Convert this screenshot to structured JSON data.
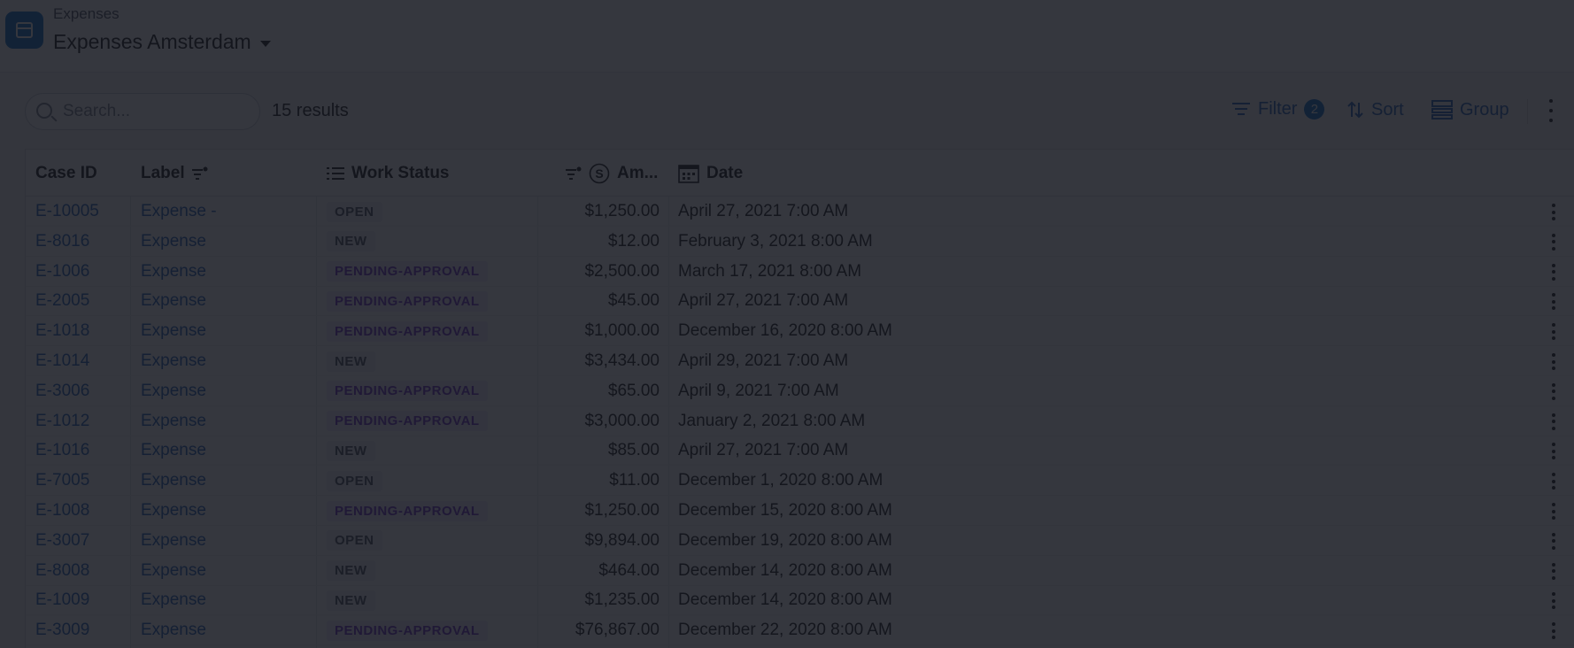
{
  "header": {
    "breadcrumb": "Expenses",
    "title": "Expenses Amsterdam"
  },
  "toolbar": {
    "search_placeholder": "Search...",
    "results": "15 results",
    "filter_label": "Filter",
    "filter_count": "2",
    "sort_label": "Sort",
    "group_label": "Group"
  },
  "table": {
    "columns": {
      "case_id": "Case ID",
      "label": "Label",
      "work_status": "Work Status",
      "amount": "Am...",
      "date": "Date"
    },
    "rows": [
      {
        "case_id": "E-10005",
        "label": "Expense -",
        "status": "OPEN",
        "amount": "$1,250.00",
        "date": "April 27, 2021 7:00 AM"
      },
      {
        "case_id": "E-8016",
        "label": "Expense",
        "status": "NEW",
        "amount": "$12.00",
        "date": "February 3, 2021 8:00 AM"
      },
      {
        "case_id": "E-1006",
        "label": "Expense",
        "status": "PENDING-APPROVAL",
        "amount": "$2,500.00",
        "date": "March 17, 2021 8:00 AM"
      },
      {
        "case_id": "E-2005",
        "label": "Expense",
        "status": "PENDING-APPROVAL",
        "amount": "$45.00",
        "date": "April 27, 2021 7:00 AM"
      },
      {
        "case_id": "E-1018",
        "label": "Expense",
        "status": "PENDING-APPROVAL",
        "amount": "$1,000.00",
        "date": "December 16, 2020 8:00 AM"
      },
      {
        "case_id": "E-1014",
        "label": "Expense",
        "status": "NEW",
        "amount": "$3,434.00",
        "date": "April 29, 2021 7:00 AM"
      },
      {
        "case_id": "E-3006",
        "label": "Expense",
        "status": "PENDING-APPROVAL",
        "amount": "$65.00",
        "date": "April 9, 2021 7:00 AM"
      },
      {
        "case_id": "E-1012",
        "label": "Expense",
        "status": "PENDING-APPROVAL",
        "amount": "$3,000.00",
        "date": "January 2, 2021 8:00 AM"
      },
      {
        "case_id": "E-1016",
        "label": "Expense",
        "status": "NEW",
        "amount": "$85.00",
        "date": "April 27, 2021 7:00 AM"
      },
      {
        "case_id": "E-7005",
        "label": "Expense",
        "status": "OPEN",
        "amount": "$11.00",
        "date": "December 1, 2020 8:00 AM"
      },
      {
        "case_id": "E-1008",
        "label": "Expense",
        "status": "PENDING-APPROVAL",
        "amount": "$1,250.00",
        "date": "December 15, 2020 8:00 AM"
      },
      {
        "case_id": "E-3007",
        "label": "Expense",
        "status": "OPEN",
        "amount": "$9,894.00",
        "date": "December 19, 2020 8:00 AM"
      },
      {
        "case_id": "E-8008",
        "label": "Expense",
        "status": "NEW",
        "amount": "$464.00",
        "date": "December 14, 2020 8:00 AM"
      },
      {
        "case_id": "E-1009",
        "label": "Expense",
        "status": "NEW",
        "amount": "$1,235.00",
        "date": "December 14, 2020 8:00 AM"
      },
      {
        "case_id": "E-3009",
        "label": "Expense",
        "status": "PENDING-APPROVAL",
        "amount": "$76,867.00",
        "date": "December 22, 2020 8:00 AM"
      }
    ]
  },
  "colors": {
    "accent": "#0b6bc7",
    "link": "#1d5fb8",
    "pending_text": "#6b2fc2",
    "overlay": "#14161e"
  },
  "icons": [
    "app-icon",
    "caret-down-icon",
    "search-icon",
    "filter-icon",
    "sort-icon",
    "group-icon",
    "more-vertical-icon",
    "sort-filter-icon",
    "list-icon",
    "dollar-icon",
    "calendar-icon"
  ]
}
